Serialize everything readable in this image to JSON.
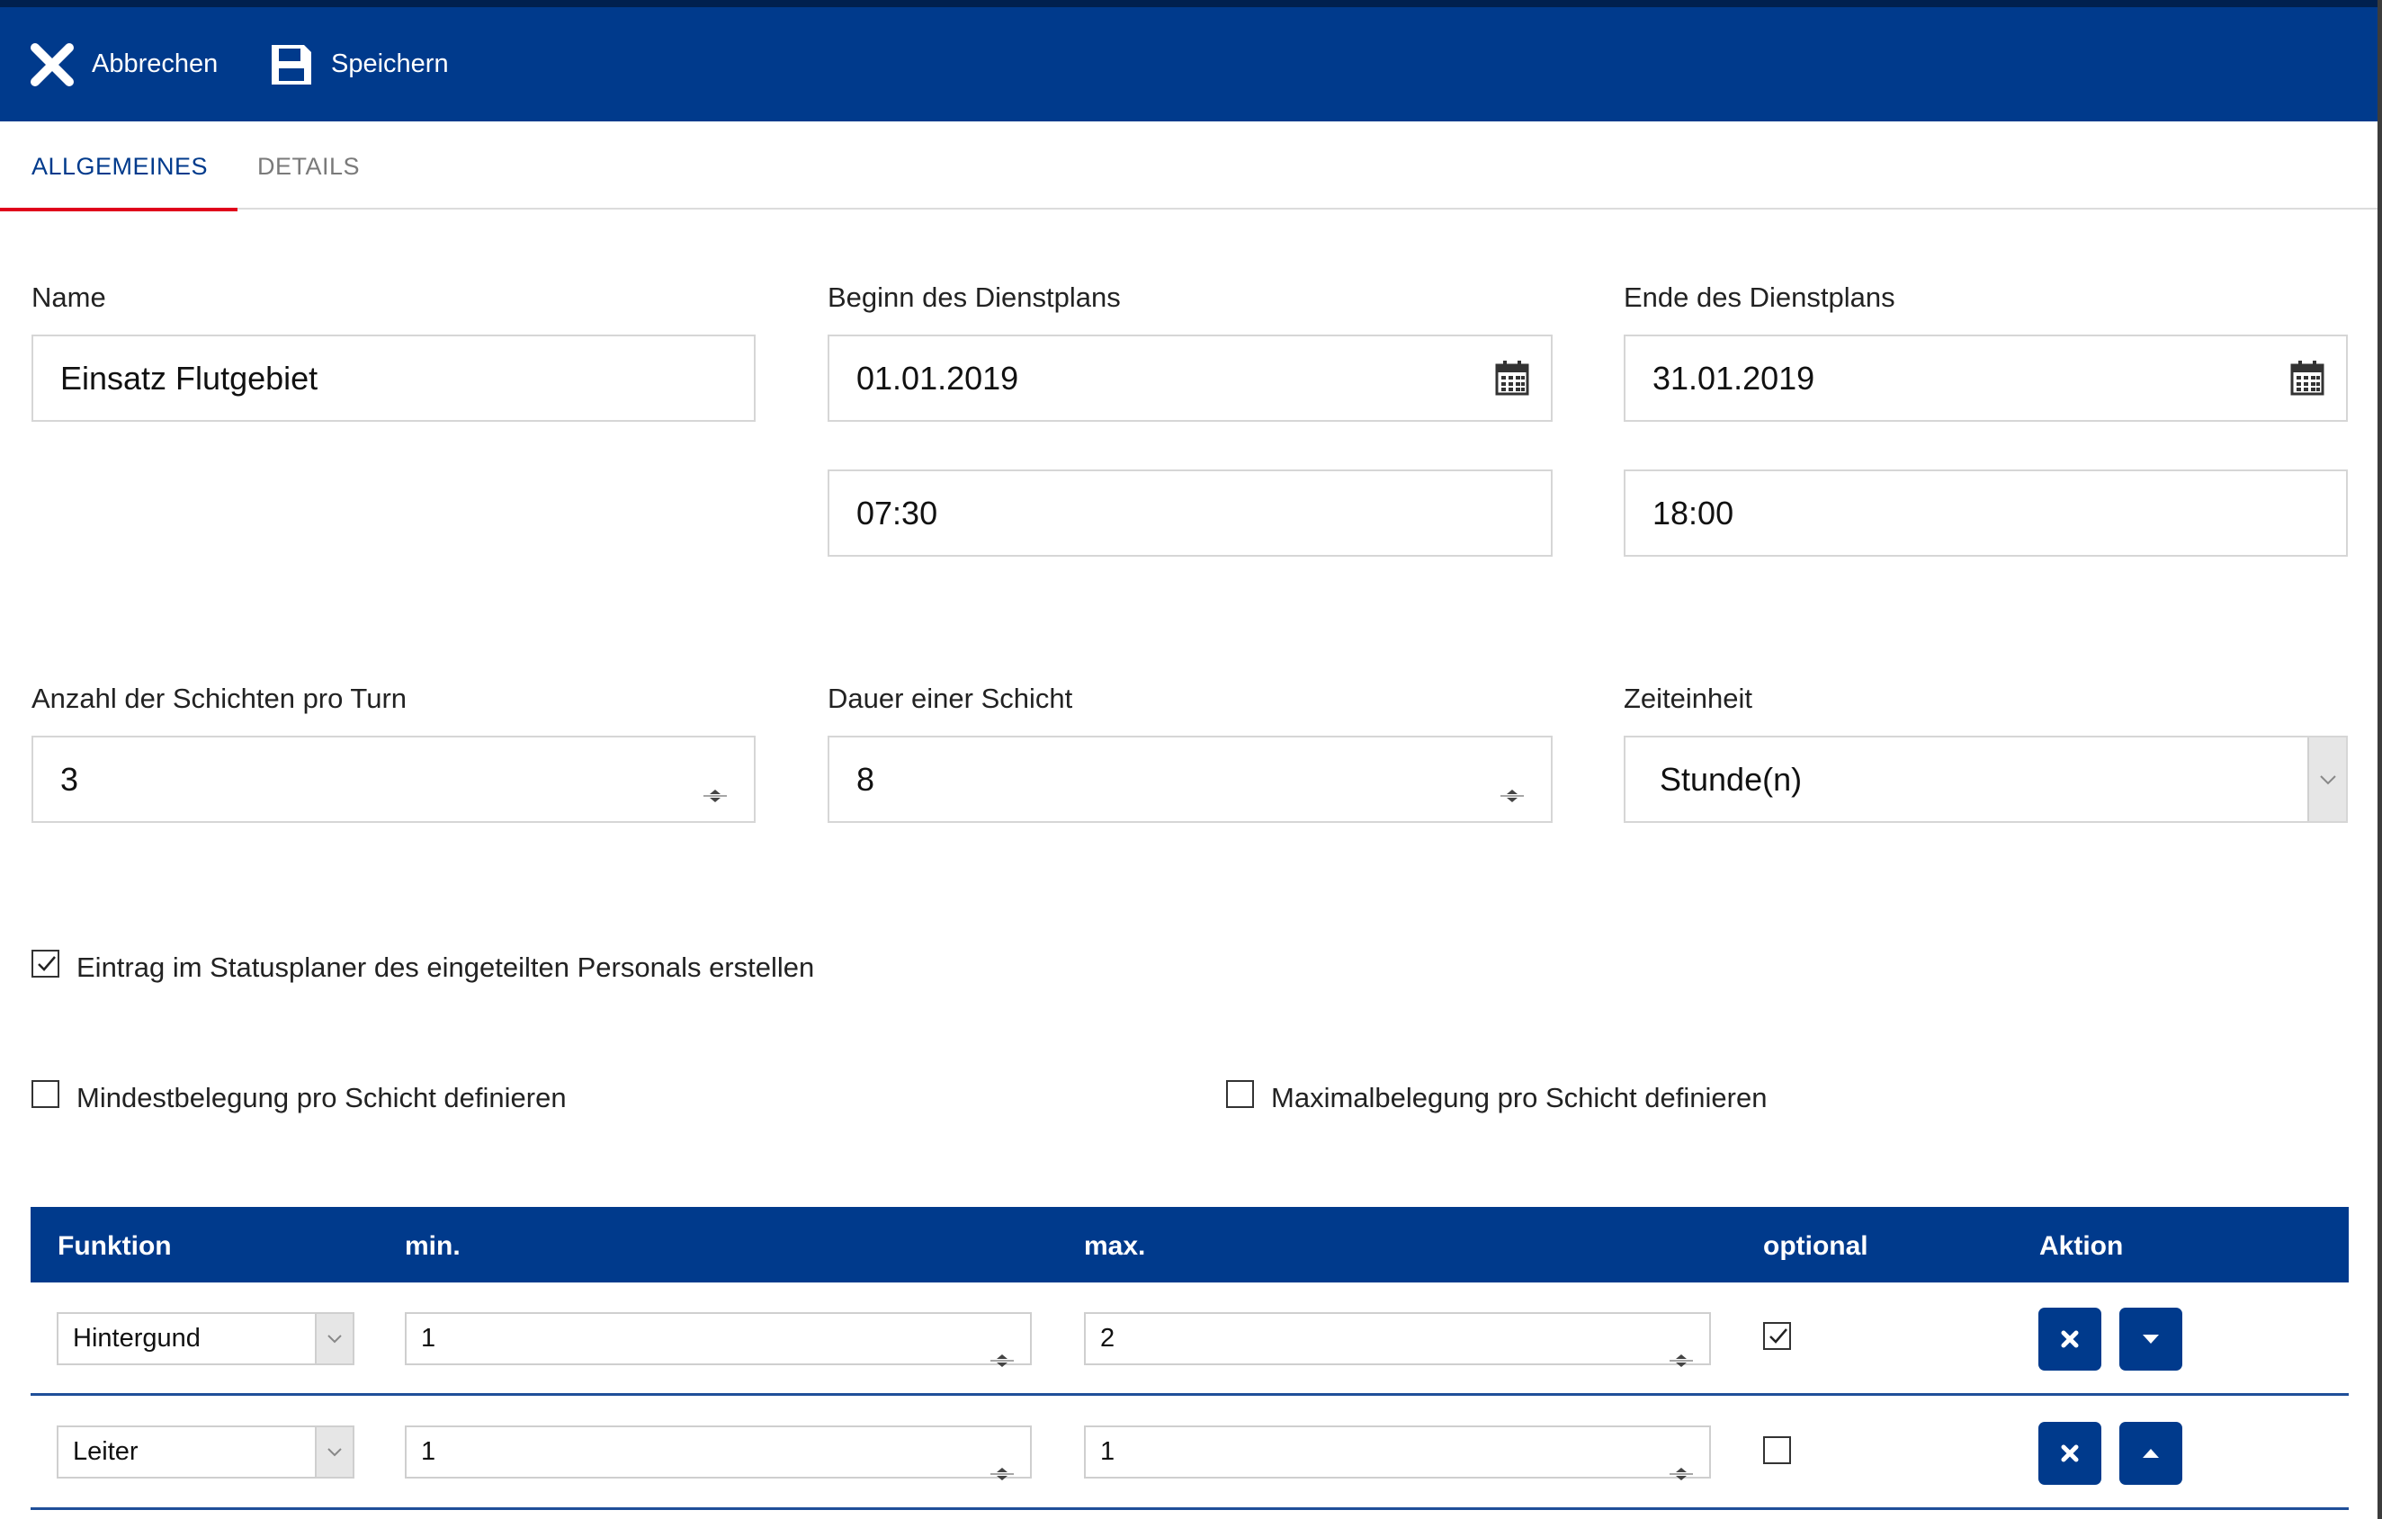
{
  "toolbar": {
    "cancel_label": "Abbrechen",
    "save_label": "Speichern"
  },
  "tabs": [
    {
      "label": "ALLGEMEINES",
      "active": true
    },
    {
      "label": "DETAILS",
      "active": false
    }
  ],
  "form": {
    "name": {
      "label": "Name",
      "value": "Einsatz Flutgebiet"
    },
    "begin": {
      "label": "Beginn des Dienstplans",
      "date": "01.01.2019",
      "time": "07:30"
    },
    "end": {
      "label": "Ende des Dienstplans",
      "date": "31.01.2019",
      "time": "18:00"
    },
    "shifts_per_turn": {
      "label": "Anzahl der Schichten pro Turn",
      "value": "3"
    },
    "shift_duration": {
      "label": "Dauer einer Schicht",
      "value": "8"
    },
    "time_unit": {
      "label": "Zeiteinheit",
      "value": "Stunde(n)"
    }
  },
  "checkboxes": {
    "status_entry": {
      "label": "Eintrag im Statusplaner des eingeteilten Personals erstellen",
      "checked": true
    },
    "min_occupancy": {
      "label": "Mindestbelegung pro Schicht definieren",
      "checked": false
    },
    "max_occupancy": {
      "label": "Maximalbelegung pro Schicht definieren",
      "checked": false
    }
  },
  "table": {
    "headers": {
      "function": "Funktion",
      "min": "min.",
      "max": "max.",
      "optional": "optional",
      "action": "Aktion"
    },
    "rows": [
      {
        "function": "Hintergund",
        "min": "1",
        "max": "2",
        "optional": true
      },
      {
        "function": "Leiter",
        "min": "1",
        "max": "1",
        "optional": false
      }
    ]
  },
  "colors": {
    "brand_blue": "#003a8c",
    "tab_underline": "#e0001b"
  }
}
